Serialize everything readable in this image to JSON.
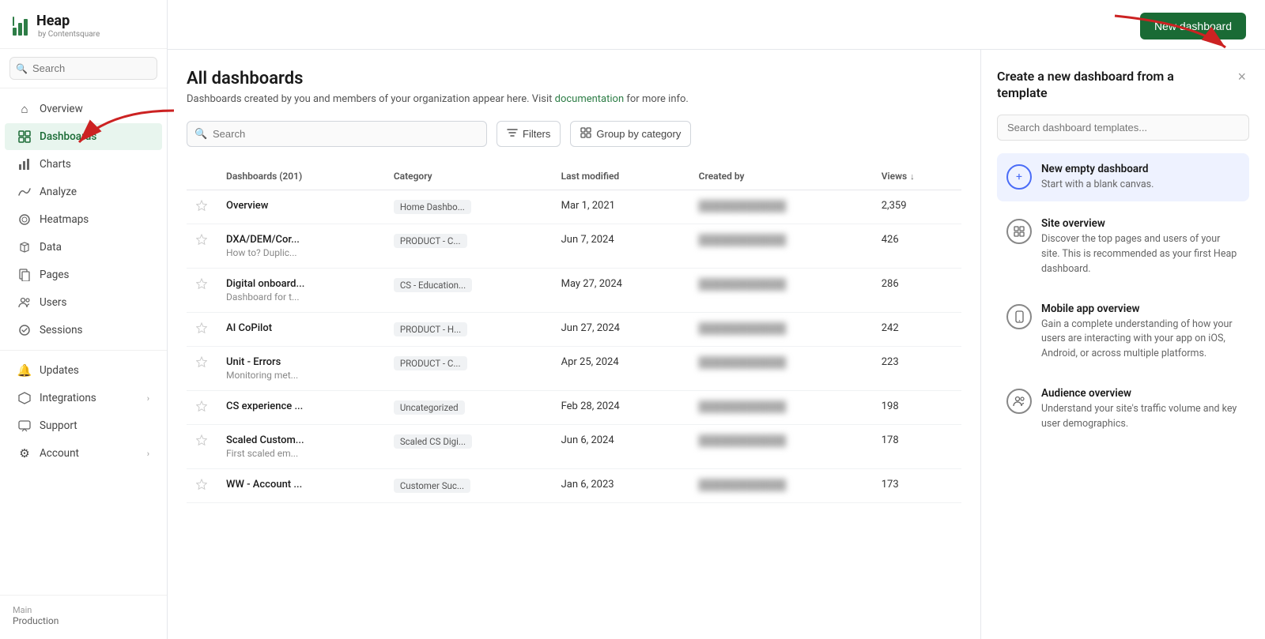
{
  "app": {
    "logo": "Heap",
    "by": "by Contentsquare",
    "env_label": "Main",
    "env_value": "Production"
  },
  "sidebar": {
    "search_placeholder": "Search",
    "items": [
      {
        "id": "overview",
        "label": "Overview",
        "icon": "⌂",
        "active": false
      },
      {
        "id": "dashboards",
        "label": "Dashboards",
        "icon": "⊞",
        "active": true
      },
      {
        "id": "charts",
        "label": "Charts",
        "icon": "▣",
        "active": false
      },
      {
        "id": "analyze",
        "label": "Analyze",
        "icon": "∿",
        "active": false
      },
      {
        "id": "heatmaps",
        "label": "Heatmaps",
        "icon": "◎",
        "active": false
      },
      {
        "id": "data",
        "label": "Data",
        "icon": "✦",
        "active": false
      },
      {
        "id": "pages",
        "label": "Pages",
        "icon": "⧉",
        "active": false
      },
      {
        "id": "users",
        "label": "Users",
        "icon": "◯◯",
        "active": false
      },
      {
        "id": "sessions",
        "label": "Sessions",
        "icon": "◯",
        "active": false
      }
    ],
    "bottom_items": [
      {
        "id": "updates",
        "label": "Updates",
        "icon": "🔔",
        "has_arrow": false
      },
      {
        "id": "integrations",
        "label": "Integrations",
        "icon": "◉",
        "has_arrow": true
      },
      {
        "id": "support",
        "label": "Support",
        "icon": "⬚",
        "has_arrow": false
      },
      {
        "id": "account",
        "label": "Account",
        "icon": "⚙",
        "has_arrow": true
      }
    ]
  },
  "header": {
    "new_dashboard_btn": "New dashboard"
  },
  "page": {
    "title": "All dashboards",
    "subtitle": "Dashboards created by you and members of your organization appear here. Visit",
    "subtitle_link": "documentation",
    "subtitle_suffix": "for more info."
  },
  "toolbar": {
    "search_placeholder": "Search",
    "filters_label": "Filters",
    "group_by_label": "Group by category"
  },
  "table": {
    "columns": [
      {
        "id": "star",
        "label": ""
      },
      {
        "id": "name",
        "label": "Dashboards (201)"
      },
      {
        "id": "category",
        "label": "Category"
      },
      {
        "id": "modified",
        "label": "Last modified"
      },
      {
        "id": "created_by",
        "label": "Created by"
      },
      {
        "id": "views",
        "label": "Views",
        "sortable": true
      }
    ],
    "rows": [
      {
        "star": false,
        "name": "Overview",
        "sub": "",
        "category": "Home Dashbo...",
        "modified": "Mar 1, 2021",
        "created_by": "blurred",
        "views": "2,359"
      },
      {
        "star": false,
        "name": "DXA/DEM/Cor...",
        "sub": "How to? Duplic...",
        "category": "PRODUCT - C...",
        "modified": "Jun 7, 2024",
        "created_by": "blurred",
        "views": "426"
      },
      {
        "star": false,
        "name": "Digital onboard...",
        "sub": "Dashboard for t...",
        "category": "CS - Education...",
        "modified": "May 27, 2024",
        "created_by": "blurred",
        "views": "286"
      },
      {
        "star": false,
        "name": "AI CoPilot",
        "sub": "",
        "category": "PRODUCT - H...",
        "modified": "Jun 27, 2024",
        "created_by": "blurred",
        "views": "242"
      },
      {
        "star": false,
        "name": "Unit - Errors",
        "sub": "Monitoring met...",
        "category": "PRODUCT - C...",
        "modified": "Apr 25, 2024",
        "created_by": "blurred",
        "views": "223"
      },
      {
        "star": false,
        "name": "CS experience ...",
        "sub": "",
        "category": "Uncategorized",
        "modified": "Feb 28, 2024",
        "created_by": "blurred",
        "views": "198"
      },
      {
        "star": false,
        "name": "Scaled Custom...",
        "sub": "First scaled em...",
        "category": "Scaled CS Digi...",
        "modified": "Jun 6, 2024",
        "created_by": "blurred",
        "views": "178"
      },
      {
        "star": false,
        "name": "WW - Account ...",
        "sub": "",
        "category": "Customer Suc...",
        "modified": "Jan 6, 2023",
        "created_by": "blurred",
        "views": "173"
      }
    ]
  },
  "template_panel": {
    "title": "Create a new dashboard from a template",
    "search_placeholder": "Search dashboard templates...",
    "close_label": "×",
    "templates": [
      {
        "id": "empty",
        "icon": "+",
        "icon_style": "circle",
        "name": "New empty dashboard",
        "desc": "Start with a blank canvas.",
        "highlighted": true
      },
      {
        "id": "site-overview",
        "icon": "⊞",
        "icon_style": "gray",
        "name": "Site overview",
        "desc": "Discover the top pages and users of your site. This is recommended as your first Heap dashboard."
      },
      {
        "id": "mobile-app",
        "icon": "📱",
        "icon_style": "phone",
        "name": "Mobile app overview",
        "desc": "Gain a complete understanding of how your users are interacting with your app on iOS, Android, or across multiple platforms."
      },
      {
        "id": "audience",
        "icon": "◯◯",
        "icon_style": "audience",
        "name": "Audience overview",
        "desc": "Understand your site's traffic volume and key user demographics."
      }
    ]
  }
}
